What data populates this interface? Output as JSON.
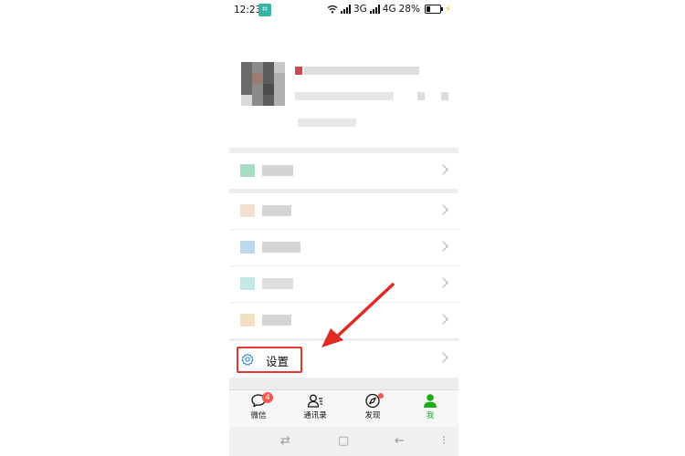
{
  "status_bar": {
    "time": "12:23",
    "network_1": "3G",
    "network_2": "4G",
    "battery_percent": "28%",
    "battery_level": 0.28
  },
  "icons": {
    "status_app": "qr-icon",
    "wifi": "wifi-icon",
    "signal": "signal-icon",
    "battery": "battery-icon",
    "settings": "gear-icon",
    "chevron": "chevron-right-icon",
    "chats": "chat-bubble-icon",
    "contacts": "contacts-icon",
    "discover": "compass-icon",
    "me": "person-icon"
  },
  "colors": {
    "accent_green": "#1aad19",
    "highlight_red": "#e33630",
    "badge_red": "#f25a4f"
  },
  "settings": {
    "label": "设置"
  },
  "tab_bar": {
    "tabs": [
      {
        "label": "微信",
        "badge": "4"
      },
      {
        "label": "通讯录"
      },
      {
        "label": "发现"
      },
      {
        "label": "我"
      }
    ]
  }
}
